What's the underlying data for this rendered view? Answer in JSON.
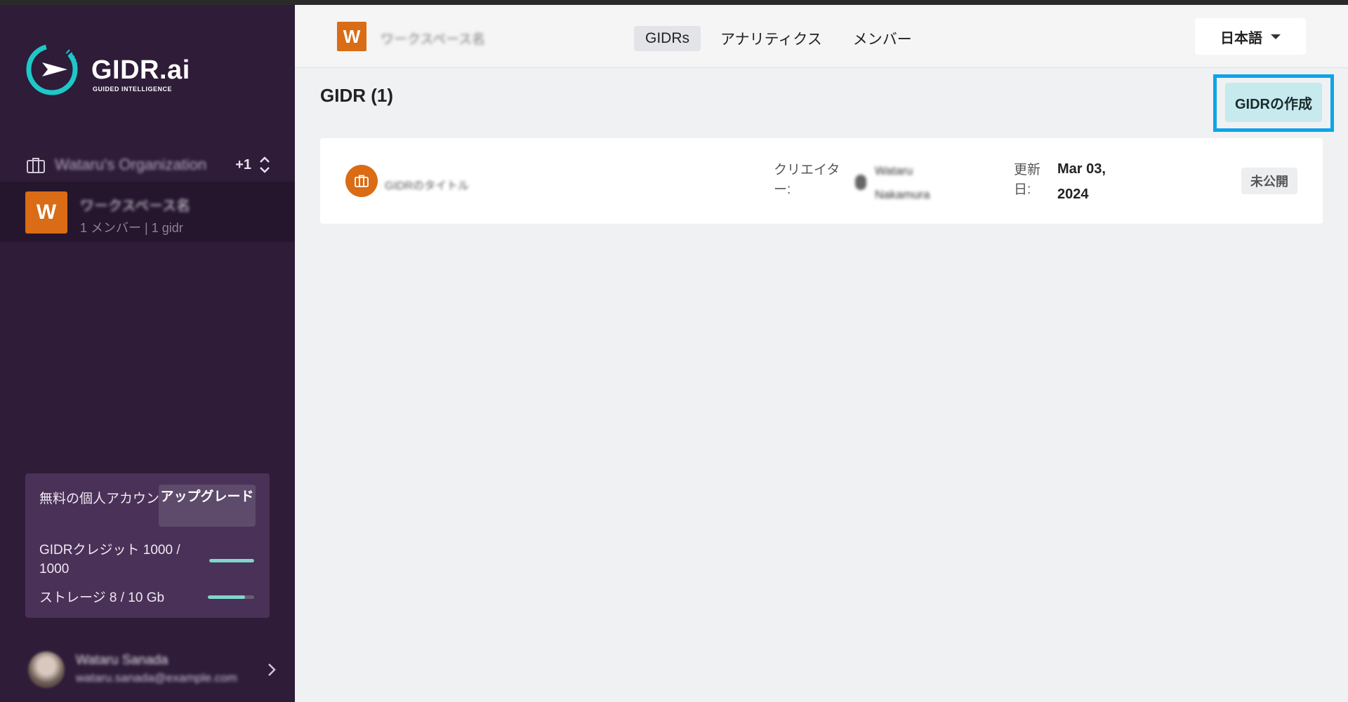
{
  "sidebar": {
    "logo": {
      "name": "GIDR.ai",
      "tagline": "GUIDED INTELLIGENCE"
    },
    "organization": {
      "name": "Wataru's Organization",
      "extra_count": "+1"
    },
    "workspace": {
      "initial": "W",
      "name": "ワークスペース名",
      "meta": "1 メンバー | 1 gidr"
    },
    "plan": {
      "title": "無料の個人アカウント",
      "upgrade_label": "アップグレード",
      "credits_label": "GIDRクレジット 1000 / 1000",
      "credits_used": 1000,
      "credits_total": 1000,
      "storage_label": "ストレージ 8 / 10 Gb",
      "storage_used": 8,
      "storage_total": 10
    },
    "user": {
      "name": "Wataru Sanada",
      "email": "wataru.sanada@example.com"
    }
  },
  "header": {
    "workspace_initial": "W",
    "workspace_name": "ワークスペース名",
    "tabs": [
      {
        "label": "GIDRs",
        "active": true
      },
      {
        "label": "アナリティクス",
        "active": false
      },
      {
        "label": "メンバー",
        "active": false
      }
    ],
    "language": "日本語"
  },
  "main": {
    "title": "GIDR (1)",
    "create_button": "GIDRの作成",
    "gidrs": [
      {
        "title": "GIDRのタイトル",
        "creator_label": "クリエイター:",
        "creator_name": "Wataru Nakamura",
        "updated_label": "更新日:",
        "updated_date": "Mar 03, 2024",
        "status": "未公開"
      }
    ]
  },
  "colors": {
    "sidebar_bg": "#2e1c38",
    "accent_orange": "#d96c15",
    "highlight_blue": "#0ea4e9",
    "create_button_bg": "#c6eaee",
    "progress_teal": "#7fd6cc"
  }
}
